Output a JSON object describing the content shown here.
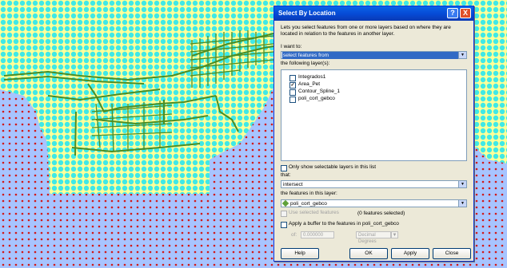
{
  "map": {
    "sea_color": "#a7c4ff",
    "land_color": "#ffff99",
    "cyan_dot_color": "#3fe9e6",
    "red_dot_color": "#d01919",
    "feature_color": "#4e8d21"
  },
  "dialog": {
    "title": "Select By Location",
    "help_glyph": "?",
    "close_glyph": "X",
    "description": "Lets you select features from one or more layers based on where they are located in relation to the features in another layer.",
    "i_want_to_label": "I want to:",
    "method": "select features from",
    "layers_label": "the following layer(s):",
    "layers": [
      {
        "name": "Integrados1",
        "checked": false
      },
      {
        "name": "Area_Pet",
        "checked": true
      },
      {
        "name": "Contour_Spline_1",
        "checked": false
      },
      {
        "name": "poli_cort_gebco",
        "checked": false
      }
    ],
    "check_mark": "✓",
    "only_selectable_label": "Only show selectable layers in this list",
    "that_label": "that:",
    "relation": "intersect",
    "features_in_layer_label": "the features in this layer:",
    "source_layer": "poli_cort_gebco",
    "use_selected_label": "Use selected features",
    "selected_count": "(0 features selected)",
    "buffer_label": "Apply a buffer to the features in poli_cort_gebco",
    "of_label": "of:",
    "buffer_value": "0.000000",
    "buffer_units": "Decimal Degrees",
    "buttons": {
      "help": "Help",
      "ok": "OK",
      "apply": "Apply",
      "close": "Close"
    },
    "icons": [
      "help-icon",
      "close-icon",
      "dropdown-arrow-icon",
      "layer-diamond-icon"
    ]
  }
}
